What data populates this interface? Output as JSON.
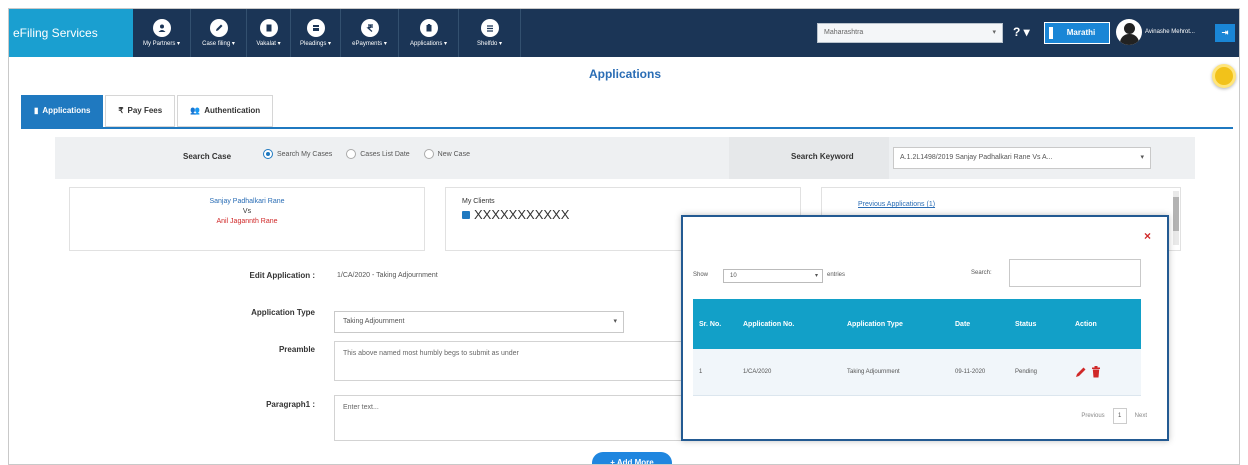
{
  "navbar": {
    "brand": "eFiling Services",
    "menu": [
      {
        "label": "My Partners ▾",
        "icon": "users-icon"
      },
      {
        "label": "Case filing ▾",
        "icon": "pencil-icon"
      },
      {
        "label": "Vakalat ▾",
        "icon": "document-icon"
      },
      {
        "label": "Pleadings ▾",
        "icon": "file-icon"
      },
      {
        "label": "ePayments ▾",
        "icon": "rupee-icon"
      },
      {
        "label": "Applications ▾",
        "icon": "clipboard-icon"
      },
      {
        "label": "Shelfdo ▾",
        "icon": "shelf-icon"
      }
    ],
    "state_value": "Maharashtra",
    "help_label": "? ▾",
    "language_label": "Marathi",
    "user_name": "Avinashe Mehrot...",
    "logout_label": "⇥"
  },
  "page_title": "Applications",
  "tabs": [
    {
      "label": "Applications",
      "icon": "document-icon",
      "active": true
    },
    {
      "label": "Pay Fees",
      "icon": "rupee-icon",
      "active": false
    },
    {
      "label": "Authentication",
      "icon": "people-icon",
      "active": false
    }
  ],
  "search": {
    "case_label": "Search Case",
    "options": [
      {
        "label": "Search My Cases",
        "checked": true
      },
      {
        "label": "Cases List Date",
        "checked": false
      },
      {
        "label": "New Case",
        "checked": false
      }
    ],
    "keyword_label": "Search Keyword",
    "keyword_value": "A.1.2L1498/2019 Sanjay Padhalkari Rane Vs A..."
  },
  "case_info": {
    "petitioner": "Sanjay Padhalkari Rane",
    "vs": "Vs",
    "respondent": "Anil Jagannth Rane",
    "clients_label": "My Clients",
    "client_value": "XXXXXXXXXXX",
    "previous_link": "Previous Applications (1)"
  },
  "form": {
    "edit_label": "Edit Application :",
    "edit_value": "1/CA/2020 - Taking Adjournment",
    "type_label": "Application Type",
    "type_value": "Taking Adjournment",
    "preamble_label": "Preamble",
    "preamble_value": "This above named most humbly begs to submit as under",
    "paragraph_label": "Paragraph1 :",
    "paragraph_placeholder": "Enter text...",
    "add_more_label": "+ Add More"
  },
  "modal": {
    "close_label": "×",
    "show_label": "Show",
    "show_value": "10",
    "entries_label": "entries",
    "search_label": "Search:",
    "columns": [
      "Sr. No.",
      "Application No.",
      "Application Type",
      "Date",
      "Status",
      "Action"
    ],
    "rows": [
      {
        "sr": "1",
        "app_no": "1/CA/2020",
        "type": "Taking Adjournment",
        "date": "09-11-2020",
        "status": "Pending"
      }
    ],
    "prev_label": "Previous",
    "page": "1",
    "next_label": "Next"
  },
  "colors": {
    "navbar": "#1b3556",
    "brand": "#1a9fd0",
    "accent": "#1f79c0",
    "table_header": "#12a0c8",
    "danger": "#d02828"
  }
}
